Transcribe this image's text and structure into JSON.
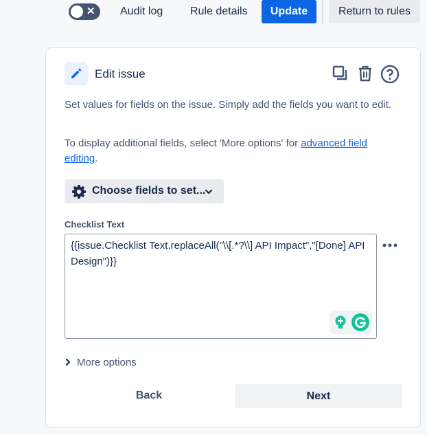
{
  "topbar": {
    "toggle_symbol": "✕",
    "audit_log_label": "Audit log",
    "rule_details_label": "Rule details",
    "update_label": "Update",
    "return_label": "Return to rules"
  },
  "component": {
    "title": "Edit issue",
    "icons": [
      "pencil-icon",
      "copy-icon",
      "trash-icon",
      "help-icon"
    ],
    "description": "Set values for fields on the issue. Simply add the fields you want to edit.",
    "more_prefix": "To display additional fields, select 'More options' for ",
    "more_link": "advanced field editing",
    "more_suffix": ".",
    "choose_label": "Choose fields to set...",
    "field_label": "Checklist Text",
    "field_value": "{{issue.Checklist Text.replaceAll(\"\\\\[.*?\\\\] API Impact\",\"[Done] API Design\")}}",
    "more_options_label": "More options",
    "back_label": "Back",
    "next_label": "Next"
  },
  "colors": {
    "primary": "#0c66e4",
    "toggle_bg": "#44546f",
    "grammarly": "#15c39a"
  }
}
